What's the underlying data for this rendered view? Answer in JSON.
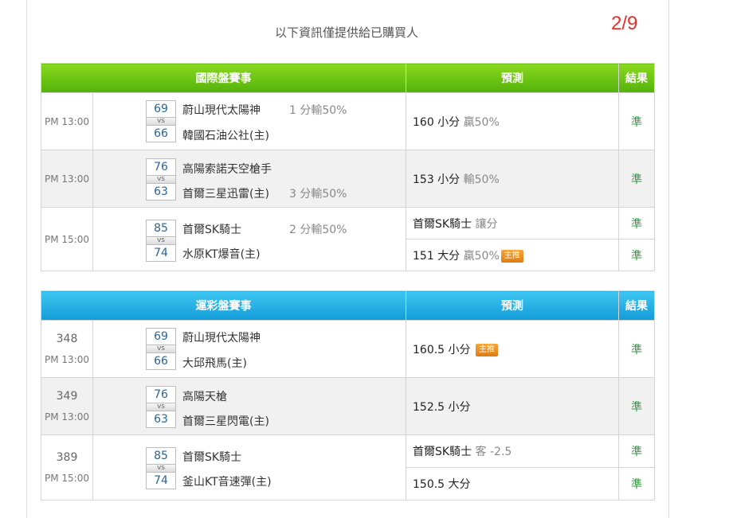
{
  "notice": "以下資訊僅提供給已購買人",
  "page_indicator": "2/9",
  "international": {
    "headers": {
      "event": "國際盤賽事",
      "prediction": "預測",
      "result": "結果"
    },
    "rows": [
      {
        "time": "PM 13:00",
        "score_a": "69",
        "vs": "vs",
        "score_b": "66",
        "team_a": "蔚山現代太陽神",
        "team_b": "韓國石油公社(主)",
        "handicap": "1 分輸50%",
        "handicap_on": "a",
        "predictions": [
          {
            "main": "160 小分",
            "rate": "贏50%",
            "tag": "",
            "result": "準"
          }
        ]
      },
      {
        "time": "PM 13:00",
        "score_a": "76",
        "vs": "vs",
        "score_b": "63",
        "team_a": "高陽索諾天空槍手",
        "team_b": "首爾三星迅雷(主)",
        "handicap": "3 分輸50%",
        "handicap_on": "b",
        "predictions": [
          {
            "main": "153 小分",
            "rate": "輸50%",
            "tag": "",
            "result": "準"
          }
        ]
      },
      {
        "time": "PM 15:00",
        "score_a": "85",
        "vs": "vs",
        "score_b": "74",
        "team_a": "首爾SK騎士",
        "team_b": "水原KT爆音(主)",
        "handicap": "2 分輸50%",
        "handicap_on": "a",
        "predictions": [
          {
            "main": "首爾SK騎士",
            "rate": "讓分",
            "tag": "",
            "result": "準"
          },
          {
            "main": "151 大分",
            "rate": "贏50%",
            "tag": "主推",
            "result": "準"
          }
        ]
      }
    ]
  },
  "sports_lottery": {
    "headers": {
      "event": "運彩盤賽事",
      "prediction": "預測",
      "result": "結果"
    },
    "rows": [
      {
        "number": "348",
        "time": "PM 13:00",
        "score_a": "69",
        "vs": "vs",
        "score_b": "66",
        "team_a": "蔚山現代太陽神",
        "team_b": "大邱飛馬(主)",
        "predictions": [
          {
            "main": "160.5 小分",
            "rate": "",
            "tag": "主推",
            "result": "準"
          }
        ]
      },
      {
        "number": "349",
        "time": "PM 13:00",
        "score_a": "76",
        "vs": "vs",
        "score_b": "63",
        "team_a": "高陽天槍",
        "team_b": "首爾三星閃電(主)",
        "predictions": [
          {
            "main": "152.5 小分",
            "rate": "",
            "tag": "",
            "result": "準"
          }
        ]
      },
      {
        "number": "389",
        "time": "PM 15:00",
        "score_a": "85",
        "vs": "vs",
        "score_b": "74",
        "team_a": "首爾SK騎士",
        "team_b": "釜山KT音速彈(主)",
        "predictions": [
          {
            "main": "首爾SK騎士",
            "rate": "客 -2.5",
            "tag": "",
            "result": "準"
          },
          {
            "main": "150.5 大分",
            "rate": "",
            "tag": "",
            "result": "準"
          }
        ]
      }
    ]
  }
}
